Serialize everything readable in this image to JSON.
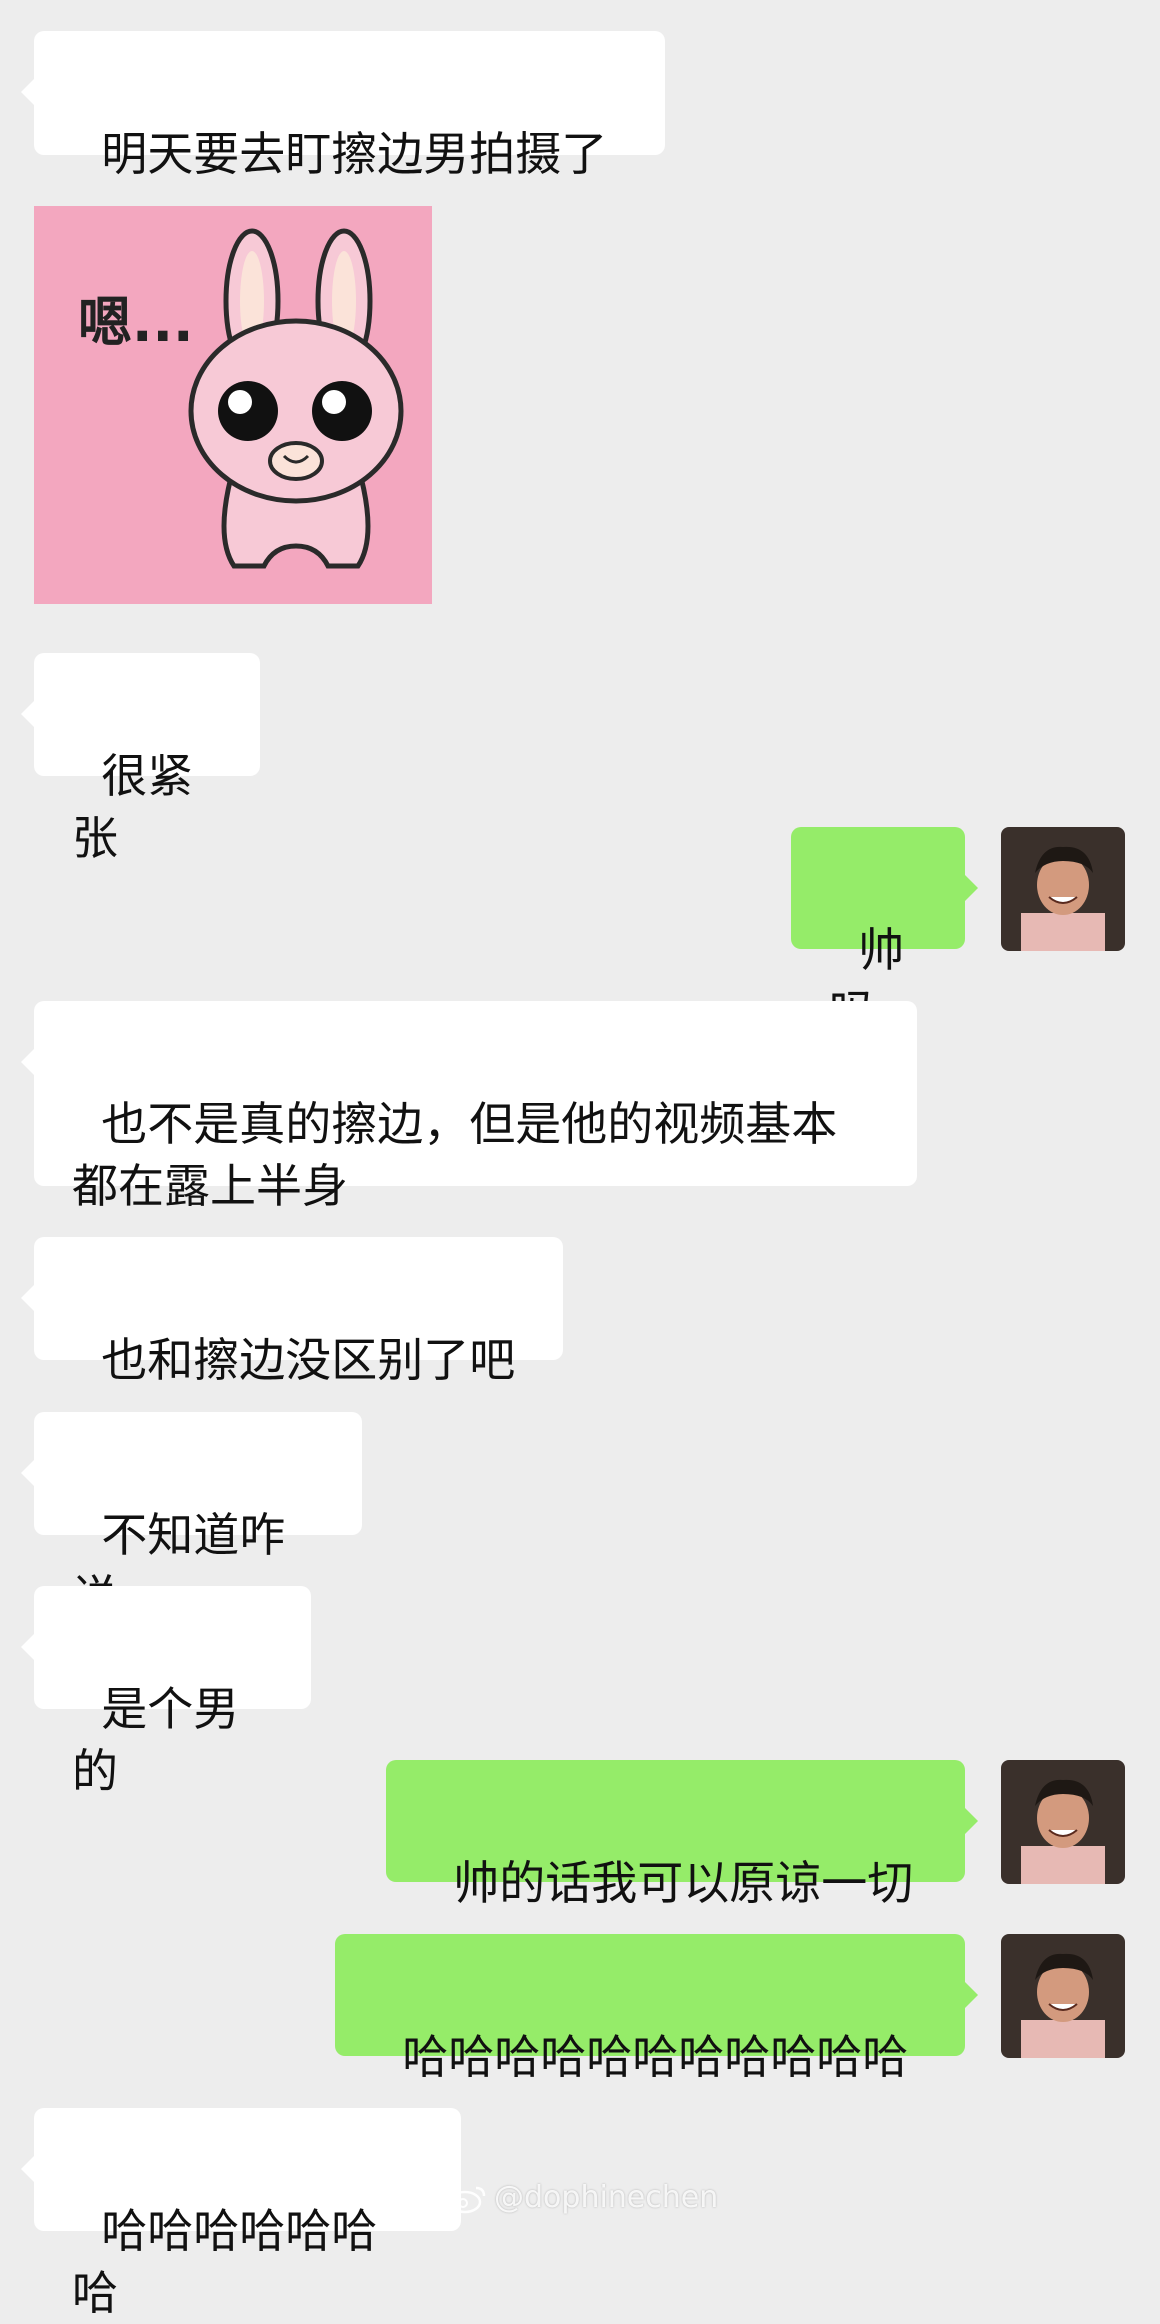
{
  "messages": [
    {
      "text": "明天要去盯擦边男拍摄了"
    },
    {
      "sticker_text": "嗯..."
    },
    {
      "text": "很紧张"
    },
    {
      "text": "帅吗"
    },
    {
      "text": "也不是真的擦边，但是他的视频基本\n都在露上半身"
    },
    {
      "text": "也和擦边没区别了吧"
    },
    {
      "text": "不知道咋说"
    },
    {
      "text": "是个男的"
    },
    {
      "text": "帅的话我可以原谅一切"
    },
    {
      "text": "哈哈哈哈哈哈哈哈哈哈哈"
    },
    {
      "text": "哈哈哈哈哈哈哈"
    }
  ],
  "watermark": {
    "text": "@dophinechen",
    "icon": "weibo-icon"
  },
  "colors": {
    "background": "#ededed",
    "incoming": "#ffffff",
    "outgoing": "#95ec69"
  }
}
